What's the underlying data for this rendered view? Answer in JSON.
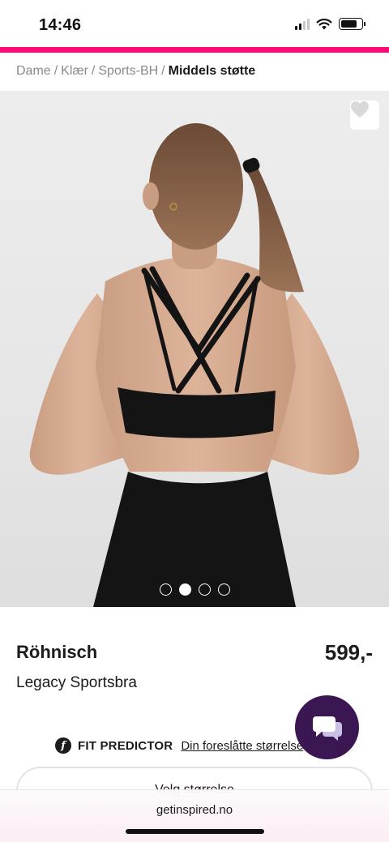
{
  "status_bar": {
    "time": "14:46",
    "battery_level": 0.8
  },
  "theme": {
    "accent_color": "#ff0a78",
    "chat_color": "#3a1752"
  },
  "breadcrumb": {
    "items": [
      "Dame",
      "Klær",
      "Sports-BH"
    ],
    "separator": "/",
    "current": "Middels støtte"
  },
  "gallery": {
    "image_count": 4,
    "active_index": 1,
    "favorite_icon": "heart-icon"
  },
  "product": {
    "brand": "Röhnisch",
    "price": "599,-",
    "name": "Legacy Sportsbra"
  },
  "fit_predictor": {
    "logo_letter": "f",
    "title": "FIT PREDICTOR",
    "link_text": "Din foreslåtte størrelse"
  },
  "size_selector": {
    "label": "Velg størrelse"
  },
  "chat": {
    "icon": "chat-bubbles-icon"
  },
  "browser": {
    "url": "getinspired.no"
  }
}
